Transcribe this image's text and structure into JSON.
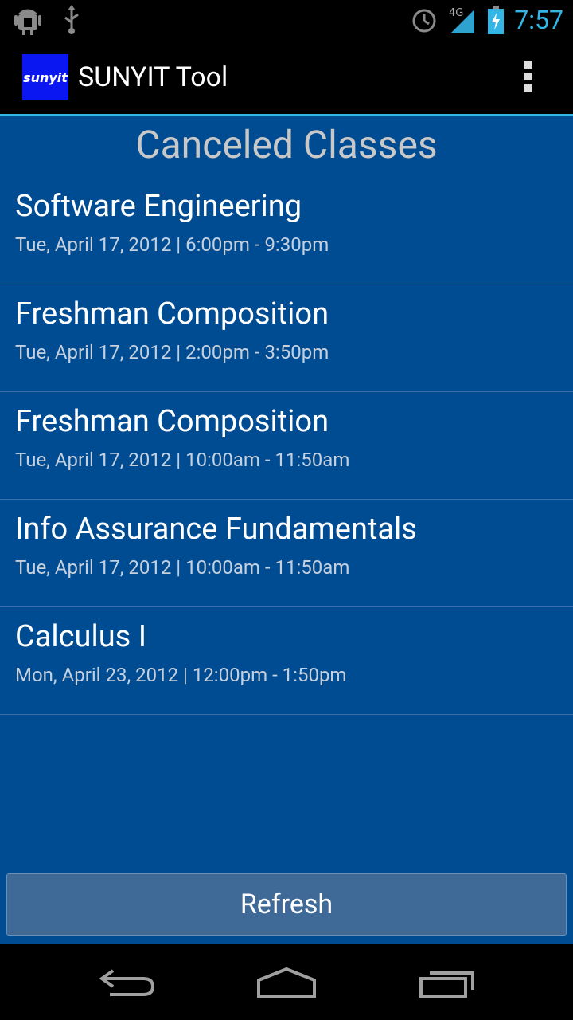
{
  "status_bar": {
    "time": "7:57",
    "network": "4G",
    "icons": [
      "android-debug-icon",
      "usb-icon",
      "alarm-icon",
      "signal-4g-icon",
      "battery-charging-icon"
    ]
  },
  "action_bar": {
    "logo_text": "sunyit",
    "title": "SUNYIT Tool"
  },
  "main": {
    "heading": "Canceled Classes",
    "classes": [
      {
        "name": "Software Engineering",
        "details": "Tue, April 17, 2012 | 6:00pm - 9:30pm"
      },
      {
        "name": "Freshman Composition",
        "details": "Tue, April 17, 2012 | 2:00pm - 3:50pm"
      },
      {
        "name": "Freshman Composition",
        "details": "Tue, April 17, 2012 | 10:00am - 11:50am"
      },
      {
        "name": "Info Assurance Fundamentals",
        "details": "Tue, April 17, 2012 | 10:00am - 11:50am"
      },
      {
        "name": "Calculus I",
        "details": "Mon, April 23, 2012 | 12:00pm - 1:50pm"
      }
    ],
    "refresh_label": "Refresh"
  },
  "colors": {
    "accent": "#33b5e5",
    "background": "#004c92",
    "button": "#3f6a98"
  }
}
